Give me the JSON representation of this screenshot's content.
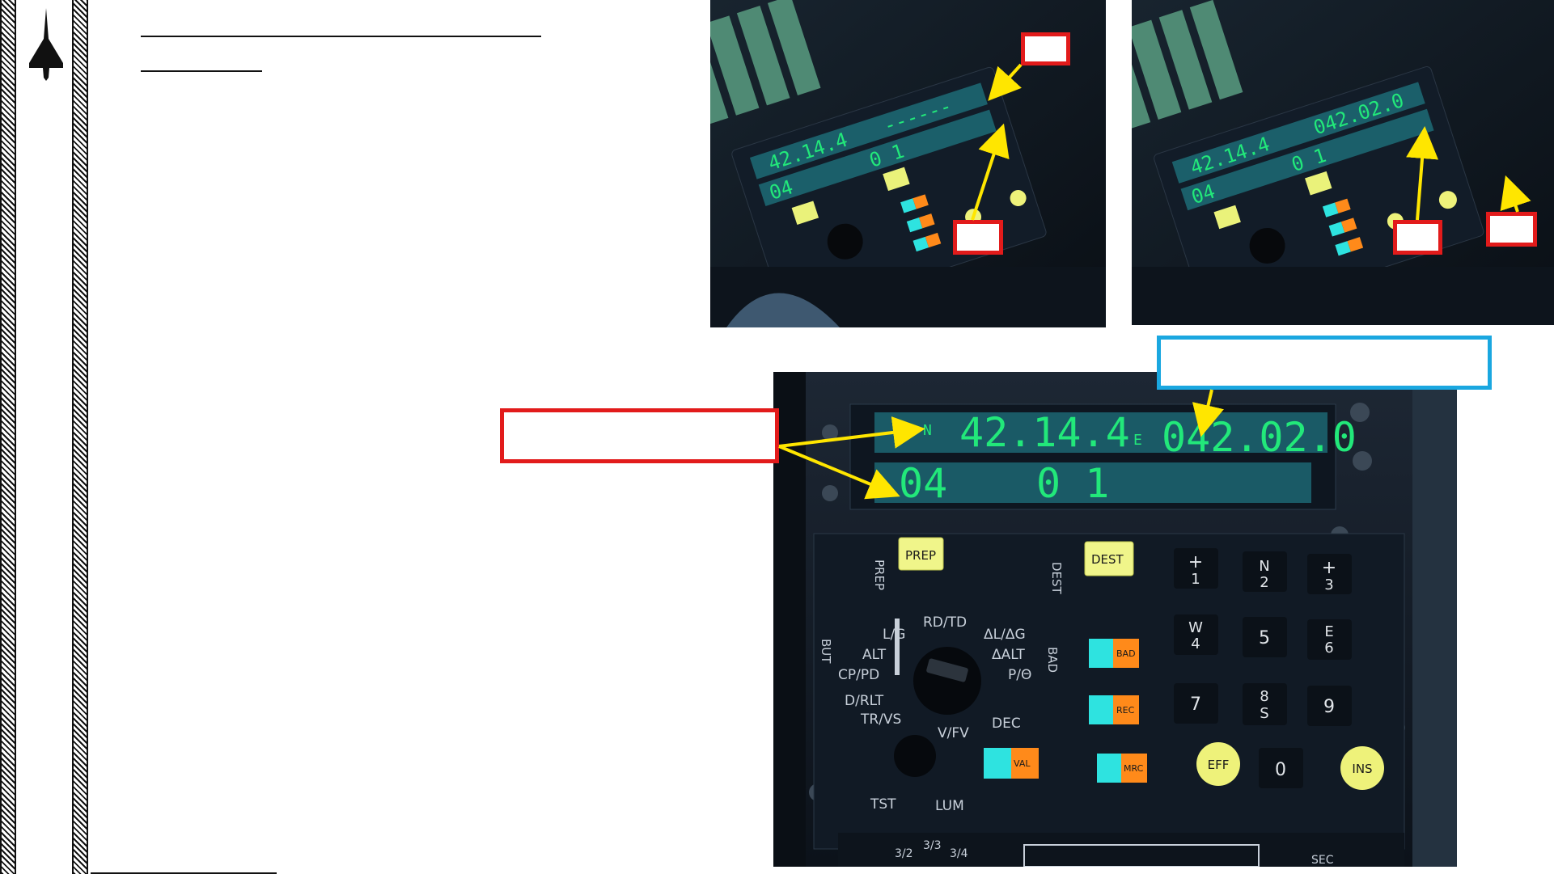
{
  "page": {
    "title": "",
    "subtitle": "",
    "body_text": "",
    "colors": {
      "callout_red": "#e21b1b",
      "callout_blue": "#1aa7e0",
      "arrow_yellow": "#ffe600",
      "display_green": "#22e87a"
    }
  },
  "sidebar": {
    "logo_icon": "aircraft-silhouette-icon"
  },
  "display": {
    "lat_prefix": "N",
    "latitude": "42.14.4",
    "lon_prefix": "E",
    "longitude": "042.02.0",
    "lon_dashes": "------",
    "field_a": "04",
    "field_b": "0 1"
  },
  "panel": {
    "prep": "PREP",
    "prep_vertical": "PREP",
    "dest": "DEST",
    "dest_vertical": "DEST",
    "but_vertical": "BUT",
    "bad_vertical": "BAD",
    "selector_labels": [
      "L/G",
      "ALT",
      "CP/PD",
      "D/RLT",
      "TR/VS",
      "RD/TD",
      "ΔL/ΔG",
      "ΔALT",
      "P/Θ",
      "V/FV",
      "DEC",
      "TST",
      "LUM"
    ],
    "indicators": [
      "BAD",
      "REC",
      "MRC",
      "VAL"
    ],
    "keys": [
      {
        "top": "+",
        "bottom": "1"
      },
      {
        "top": "N",
        "bottom": "2"
      },
      {
        "top": "+",
        "bottom": "3"
      },
      {
        "top": "W",
        "bottom": "4"
      },
      {
        "top": "",
        "bottom": "5"
      },
      {
        "top": "E",
        "bottom": "6"
      },
      {
        "top": "",
        "bottom": "7"
      },
      {
        "top": "8",
        "bottom": "S"
      },
      {
        "top": "",
        "bottom": "9"
      },
      {
        "top": "",
        "bottom": "EFF"
      },
      {
        "top": "",
        "bottom": "0"
      },
      {
        "top": "",
        "bottom": "INS"
      }
    ],
    "bottom_labels": [
      "3/2",
      "3/3",
      "3/4",
      "SEC"
    ]
  },
  "callouts": {
    "top_left_1": "",
    "top_left_2": "",
    "top_right_1": "",
    "top_right_2": "",
    "main_left": "",
    "main_top": ""
  }
}
